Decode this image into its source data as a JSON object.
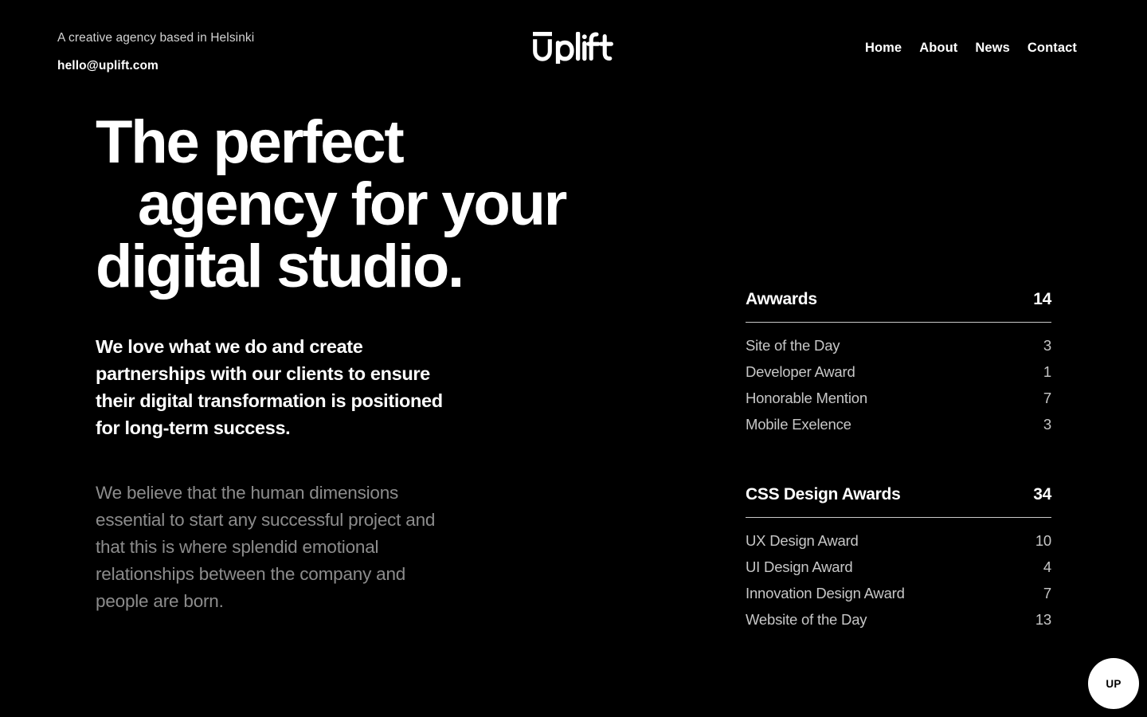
{
  "meta": {
    "background_color": "#000000",
    "text_color": "#ffffff",
    "muted_text_color": "#8c8c8c",
    "list_text_color": "#c7c7c7",
    "rule_color": "#c9c9c9",
    "accent_color": "#ffffff"
  },
  "header": {
    "tagline": "A creative agency based in Helsinki",
    "email": "hello@uplift.com",
    "logo": {
      "text": "Uplift",
      "wordmark_suffix": "plift",
      "icon_name": "uplift-u-mark"
    },
    "nav": [
      {
        "label": "Home"
      },
      {
        "label": "About"
      },
      {
        "label": "News"
      },
      {
        "label": "Contact"
      }
    ]
  },
  "hero": {
    "headline_lines": [
      "The perfect",
      "agency for your",
      "digital studio."
    ],
    "lede": "We love what we do and create partnerships with our clients to ensure their digital transformation is positioned for long-term success.",
    "subtext": "We believe that the human dimensions essential to start any successful project and that this is where splendid emotional relationships between the company and people are born."
  },
  "awards": [
    {
      "title": "Awwards",
      "count": "14",
      "rows": [
        {
          "name": "Site of the Day",
          "value": "3"
        },
        {
          "name": "Developer Award",
          "value": "1"
        },
        {
          "name": "Honorable Mention",
          "value": "7"
        },
        {
          "name": "Mobile Exelence",
          "value": "3"
        }
      ]
    },
    {
      "title": "CSS Design Awards",
      "count": "34",
      "rows": [
        {
          "name": "UX Design Award",
          "value": "10"
        },
        {
          "name": "UI Design Award",
          "value": "4"
        },
        {
          "name": "Innovation Design Award",
          "value": "7"
        },
        {
          "name": "Website of the Day",
          "value": "13"
        }
      ]
    }
  ],
  "scroll_top_button": {
    "label": "UP",
    "icon_name": "scroll-to-top-icon"
  }
}
